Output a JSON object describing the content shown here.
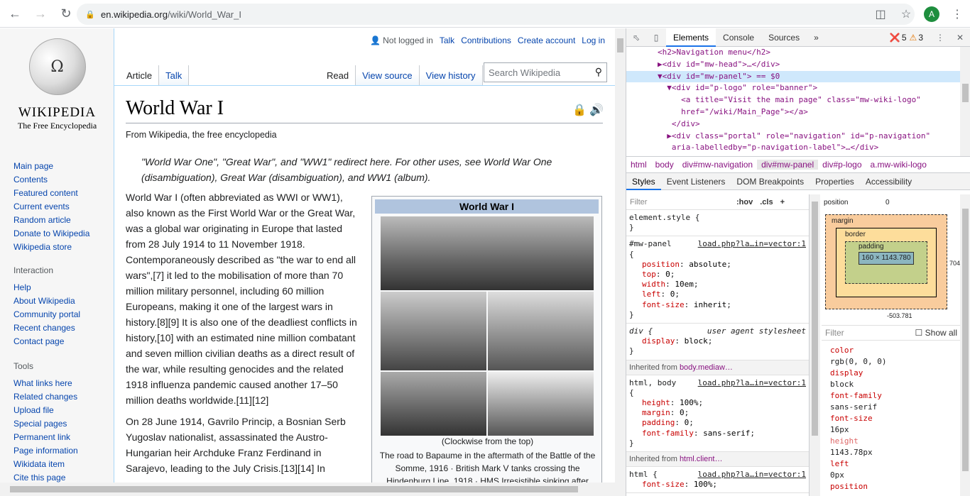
{
  "browser": {
    "url_host": "en.wikipedia.org",
    "url_path": "/wiki/World_War_I",
    "avatar_letter": "A"
  },
  "wiki": {
    "wordmark": "Wikipedia",
    "tagline": "The Free Encyclopedia",
    "nav": [
      "Main page",
      "Contents",
      "Featured content",
      "Current events",
      "Random article",
      "Donate to Wikipedia",
      "Wikipedia store"
    ],
    "interaction_heading": "Interaction",
    "interaction": [
      "Help",
      "About Wikipedia",
      "Community portal",
      "Recent changes",
      "Contact page"
    ],
    "tools_heading": "Tools",
    "tools": [
      "What links here",
      "Related changes",
      "Upload file",
      "Special pages",
      "Permanent link",
      "Page information",
      "Wikidata item",
      "Cite this page"
    ],
    "personal": {
      "status": "Not logged in",
      "talk": "Talk",
      "contributions": "Contributions",
      "create": "Create account",
      "login": "Log in"
    },
    "tabs_left": [
      "Article",
      "Talk"
    ],
    "tabs_right": [
      "Read",
      "View source",
      "View history"
    ],
    "search_placeholder": "Search Wikipedia",
    "title": "World War I",
    "from": "From Wikipedia, the free encyclopedia",
    "hatnote": "\"World War One\", \"Great War\", and \"WW1\" redirect here. For other uses, see World War One (disambiguation), Great War (disambiguation), and WW1 (album).",
    "infobox_title": "World War I",
    "caption1": "(Clockwise from the top)",
    "caption2": "The road to Bapaume in the aftermath of the Battle of the Somme, 1916 · British Mark V tanks crossing the Hindenburg Line, 1918 · HMS Irresistible sinking after",
    "para1": "World War I (often abbreviated as WWI or WW1), also known as the First World War or the Great War, was a global war originating in Europe that lasted from 28 July 1914 to 11 November 1918. Contemporaneously described as \"the war to end all wars\",[7] it led to the mobilisation of more than 70 million military personnel, including 60 million Europeans, making it one of the largest wars in history.[8][9] It is also one of the deadliest conflicts in history,[10] with an estimated nine million combatant and seven million civilian deaths as a direct result of the war, while resulting genocides and the related 1918 influenza pandemic caused another 17–50 million deaths worldwide.[11][12]",
    "para2": "On 28 June 1914, Gavrilo Princip, a Bosnian Serb Yugoslav nationalist, assassinated the Austro-Hungarian heir Archduke Franz Ferdinand in Sarajevo, leading to the July Crisis.[13][14] In"
  },
  "devtools": {
    "tabs": [
      "Elements",
      "Console",
      "Sources"
    ],
    "errors": "5",
    "warnings": "3",
    "dom_lines": [
      "<h2>Navigation menu</h2>",
      "▶<div id=\"mw-head\">…</div>",
      "▼<div id=\"mw-panel\"> == $0",
      "  ▼<div id=\"p-logo\" role=\"banner\">",
      "     <a title=\"Visit the main page\" class=\"mw-wiki-logo\"",
      "     href=\"/wiki/Main_Page\"></a>",
      "   </div>",
      "  ▶<div class=\"portal\" role=\"navigation\" id=\"p-navigation\"",
      "   aria-labelledby=\"p-navigation-label\">…</div>"
    ],
    "breadcrumbs": [
      "html",
      "body",
      "div#mw-navigation",
      "div#mw-panel",
      "div#p-logo",
      "a.mw-wiki-logo"
    ],
    "subtabs": [
      "Styles",
      "Event Listeners",
      "DOM Breakpoints",
      "Properties",
      "Accessibility"
    ],
    "filter": "Filter",
    "hov": ":hov",
    "cls": ".cls",
    "rule1_sel": "element.style {",
    "rule2_sel": "#mw-panel",
    "rule2_src": "load.php?la…in=vector:1",
    "rule2_props": [
      [
        "position",
        "absolute"
      ],
      [
        "top",
        "0"
      ],
      [
        "width",
        "10em"
      ],
      [
        "left",
        "0"
      ],
      [
        "font-size",
        "inherit"
      ]
    ],
    "rule3_sel": "div {",
    "rule3_src": "user agent stylesheet",
    "rule3_props": [
      [
        "display",
        "block"
      ]
    ],
    "inherited1": "Inherited from",
    "inherited1_el": "body.mediaw…",
    "rule4_sel": "html, body",
    "rule4_src": "load.php?la…in=vector:1",
    "rule4_props": [
      [
        "height",
        "100%"
      ],
      [
        "margin",
        "0"
      ],
      [
        "padding",
        "0"
      ],
      [
        "font-family",
        "sans-serif"
      ]
    ],
    "inherited2_el": "html.client…",
    "rule5_sel": "html {",
    "rule5_src": "load.php?la…in=vector:1",
    "rule5_props": [
      [
        "font-size",
        "100%"
      ]
    ],
    "box": {
      "position_label": "position",
      "position_val": "0",
      "margin": "margin",
      "border": "border",
      "padding": "padding",
      "content": "160 × 1143.780",
      "bottom": "-503.781",
      "right": "704"
    },
    "computed_filter": "Filter",
    "show_all": "Show all",
    "computed": [
      [
        "color",
        "rgb(0, 0, 0)"
      ],
      [
        "display",
        "block"
      ],
      [
        "font-family",
        "sans-serif"
      ],
      [
        "font-size",
        "16px"
      ],
      [
        "height",
        "1143.78px"
      ],
      [
        "left",
        "0px"
      ],
      [
        "position",
        ""
      ]
    ]
  }
}
